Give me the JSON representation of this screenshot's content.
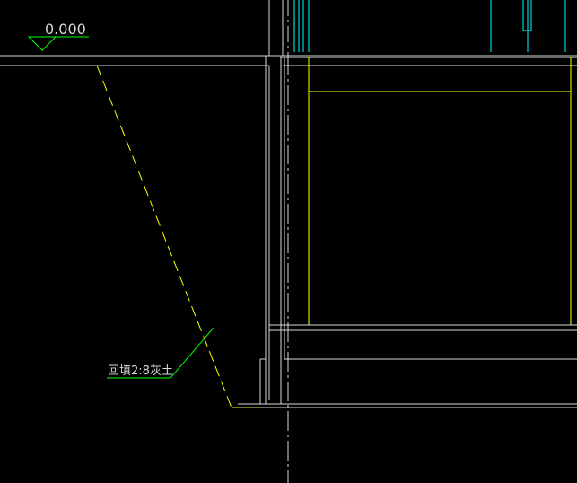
{
  "drawing": {
    "elevation_label": "0.000",
    "backfill_note": "回填2:8灰土"
  },
  "colors": {
    "background": "#000000",
    "green": "#00ff00",
    "white": "#d9d9d9",
    "yellow": "#ffff00",
    "cyan": "#00ffff",
    "gray": "#bfbfbf"
  }
}
